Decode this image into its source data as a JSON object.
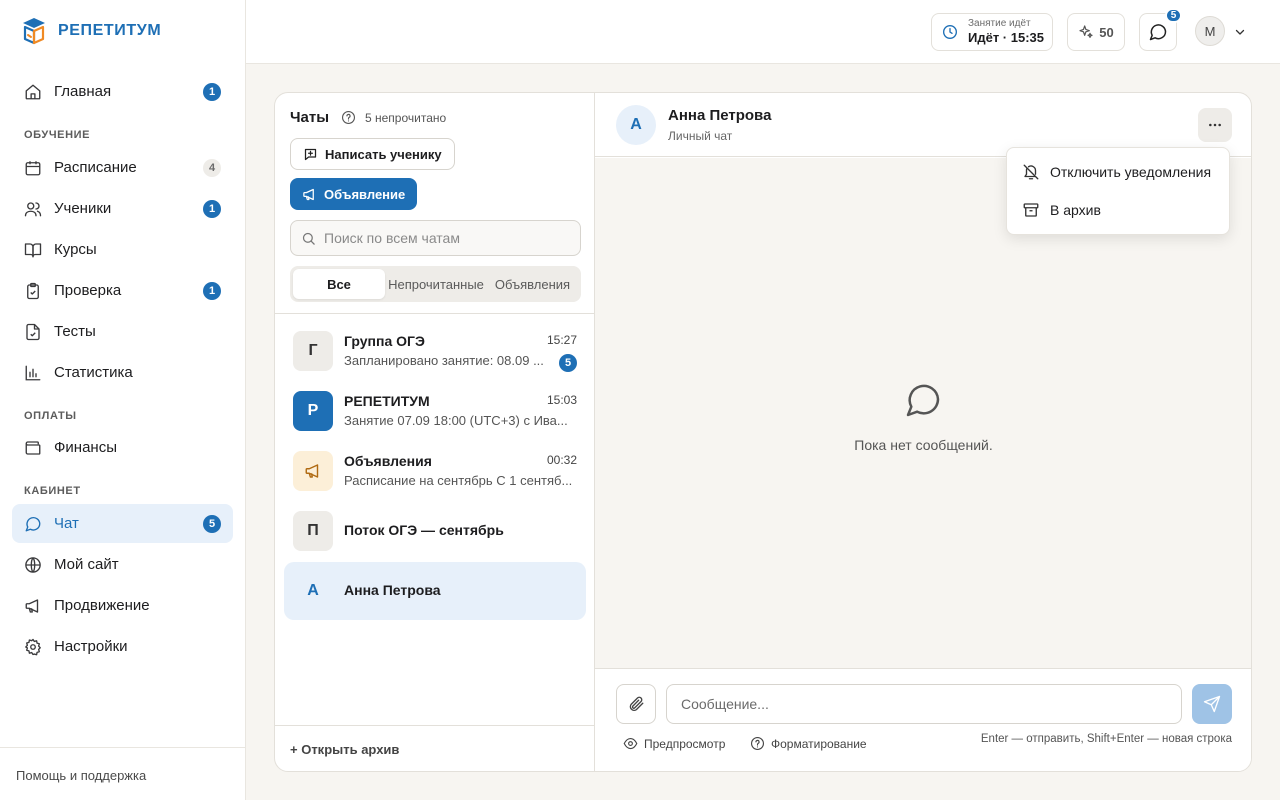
{
  "brand": {
    "name": "РЕПЕТИТУМ",
    "accent": "#1e6fb5"
  },
  "sidebar": {
    "items": [
      {
        "label": "Главная",
        "icon": "home-icon",
        "badge": "1"
      },
      {
        "label": "Расписание",
        "icon": "calendar-icon",
        "badge": "4"
      },
      {
        "label": "Ученики",
        "icon": "users-icon",
        "badge": "1"
      },
      {
        "label": "Курсы",
        "icon": "book-icon",
        "badge": ""
      },
      {
        "label": "Проверка",
        "icon": "clipboard-check-icon",
        "badge": "1"
      },
      {
        "label": "Тесты",
        "icon": "file-check-icon",
        "badge": ""
      },
      {
        "label": "Статистика",
        "icon": "bar-chart-icon",
        "badge": ""
      },
      {
        "label": "Финансы",
        "icon": "wallet-icon",
        "badge": ""
      },
      {
        "label": "Чат",
        "icon": "chat-icon",
        "badge": "5"
      },
      {
        "label": "Мой сайт",
        "icon": "globe-icon",
        "badge": ""
      },
      {
        "label": "Продвижение",
        "icon": "megaphone-icon",
        "badge": ""
      },
      {
        "label": "Настройки",
        "icon": "gear-icon",
        "badge": ""
      }
    ],
    "sections": {
      "learning": "ОБУЧЕНИЕ",
      "payments": "ОПЛАТЫ",
      "cabinet": "КАБИНЕТ"
    },
    "footer": "Помощь и поддержка"
  },
  "topbar": {
    "lesson_caption": "Занятие идёт",
    "lesson_status": "Идёт · 15:35",
    "credits": "50",
    "chat_badge": "5",
    "avatar_initial": "М"
  },
  "chats": {
    "title": "Чаты",
    "unread_label": "5 непрочитано",
    "write_button": "Написать ученику",
    "announce_button": "Объявление",
    "search_placeholder": "Поиск по всем чатам",
    "tabs": [
      "Все",
      "Непрочитанные",
      "Объявления"
    ],
    "list": [
      {
        "initial": "Г",
        "name": "Группа ОГЭ",
        "time": "15:27",
        "preview": "Запланировано занятие: 08.09 ...",
        "badge": "5"
      },
      {
        "initial": "Р",
        "name": "РЕПЕТИТУМ",
        "time": "15:03",
        "preview": "Занятие 07.09 18:00 (UTC+3) с Ива...",
        "badge": ""
      },
      {
        "initial": "",
        "name": "Объявления",
        "time": "00:32",
        "preview": "Расписание на сентябрь С 1 сентяб...",
        "badge": ""
      },
      {
        "initial": "П",
        "name": "Поток ОГЭ — сентябрь",
        "time": "",
        "preview": "",
        "badge": ""
      },
      {
        "initial": "А",
        "name": "Анна Петрова",
        "time": "",
        "preview": "",
        "badge": ""
      }
    ],
    "open_archive": "+ Открыть архив"
  },
  "conversation": {
    "initial": "А",
    "name": "Анна Петрова",
    "subtitle": "Личный чат",
    "empty_text": "Пока нет сообщений.",
    "menu": [
      "Отключить уведомления",
      "В архив"
    ],
    "composer": {
      "placeholder": "Сообщение...",
      "preview_label": "Предпросмотр",
      "formatting_label": "Форматирование",
      "hint": "Enter — отправить, Shift+Enter — новая строка"
    }
  }
}
